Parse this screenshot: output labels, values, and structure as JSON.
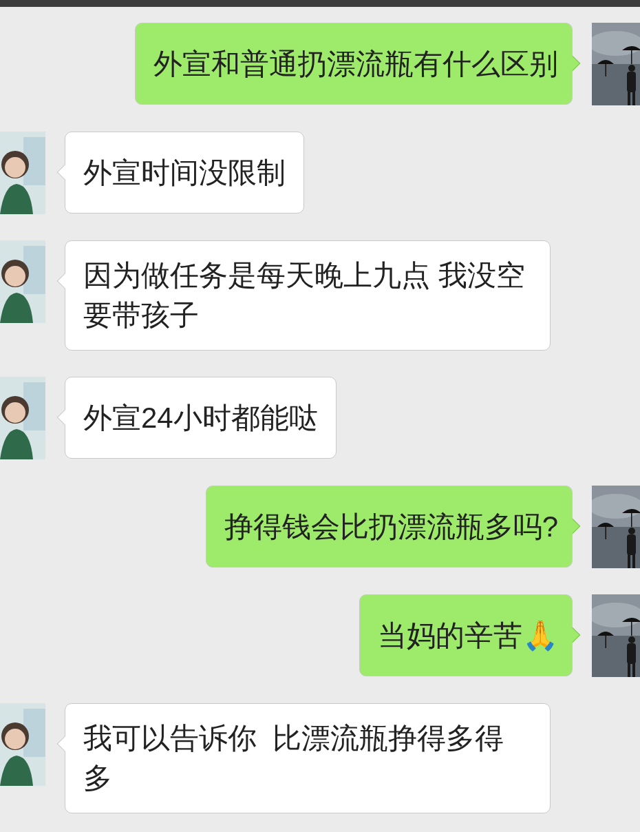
{
  "messages": [
    {
      "kind": "sent",
      "text": "外宣和普通扔漂流瓶有什么区别"
    },
    {
      "kind": "received",
      "text": "外宣时间没限制"
    },
    {
      "kind": "received",
      "text": "因为做任务是每天晚上九点 我没空要带孩子"
    },
    {
      "kind": "received",
      "text": "外宣24小时都能哒"
    },
    {
      "kind": "sent",
      "text": "挣得钱会比扔漂流瓶多吗?"
    },
    {
      "kind": "sent",
      "text": "当妈的辛苦🙏"
    },
    {
      "kind": "received",
      "text": "我可以告诉你  比漂流瓶挣得多得多"
    }
  ]
}
